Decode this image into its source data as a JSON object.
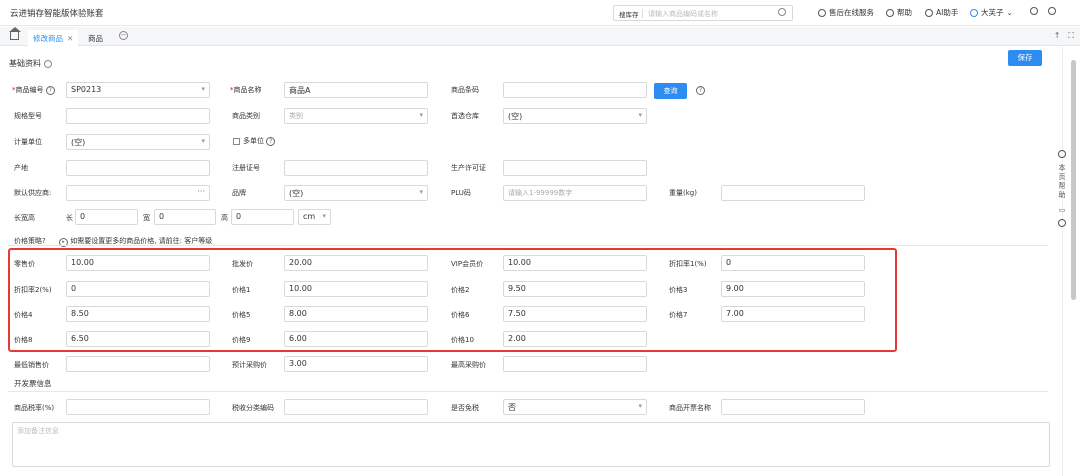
{
  "app_title": "云进销存智能版体验账套",
  "search": {
    "library": "搜库存",
    "placeholder": "请输入商品编码或名称"
  },
  "top_links": {
    "service": "售后在线服务",
    "help": "帮助",
    "ai": "AI助手",
    "user": "大芙子"
  },
  "tabs": [
    {
      "label": "修改商品",
      "close": "✕"
    },
    {
      "label": "商品"
    }
  ],
  "basic": {
    "title": "基础资料",
    "save": "保存"
  },
  "fields": {
    "code_label": "商品编号",
    "code_value": "SP0213",
    "name_label": "商品名称",
    "name_value": "商品A",
    "barcode_label": "商品条码",
    "query": "查询",
    "spec_label": "规格型号",
    "category_label": "商品类别",
    "category_value": "类别",
    "warehouse_label": "首选仓库",
    "warehouse_value": "(空)",
    "unit_label": "计量单位",
    "unit_value": "(空)",
    "multi_unit": "多单位",
    "origin_label": "产地",
    "reg_label": "注册证号",
    "license_label": "生产许可证",
    "supplier_label": "默认供应商:",
    "brand_label": "品牌",
    "brand_value": "(空)",
    "plu_label": "PLU码",
    "plu_placeholder": "请输入1-99999数字",
    "weight_label": "重量(kg)",
    "lwh_label": "长宽高",
    "l": "长",
    "l_val": "0",
    "w": "宽",
    "w_val": "0",
    "h": "高",
    "h_val": "0",
    "unit_cm": "cm"
  },
  "price_strategy": {
    "label": "价格策略?",
    "hint": "如需要设置更多的商品价格, 请前往: 客户等级"
  },
  "prices": [
    {
      "label": "零售价",
      "value": "10.00"
    },
    {
      "label": "批发价",
      "value": "20.00"
    },
    {
      "label": "VIP会员价",
      "value": "10.00"
    },
    {
      "label": "折扣率1(%)",
      "value": "0"
    },
    {
      "label": "折扣率2(%)",
      "value": "0"
    },
    {
      "label": "价格1",
      "value": "10.00"
    },
    {
      "label": "价格2",
      "value": "9.50"
    },
    {
      "label": "价格3",
      "value": "9.00"
    },
    {
      "label": "价格4",
      "value": "8.50"
    },
    {
      "label": "价格5",
      "value": "8.00"
    },
    {
      "label": "价格6",
      "value": "7.50"
    },
    {
      "label": "价格7",
      "value": "7.00"
    },
    {
      "label": "价格8",
      "value": "6.50"
    },
    {
      "label": "价格9",
      "value": "6.00"
    },
    {
      "label": "价格10",
      "value": "2.00"
    }
  ],
  "extra": {
    "min_sale_label": "最低销售价",
    "est_purchase_label": "预计采购价",
    "est_purchase_value": "3.00",
    "max_purchase_label": "最高采购价"
  },
  "invoice": {
    "title": "开发票信息",
    "tax_label": "商品税率(%)",
    "tax_code_label": "税收分类编码",
    "exempt_label": "是否免税",
    "exempt_value": "否",
    "invoice_name_label": "商品开票名称"
  },
  "remark_placeholder": "添加备注信息",
  "side_help": "本页帮助"
}
